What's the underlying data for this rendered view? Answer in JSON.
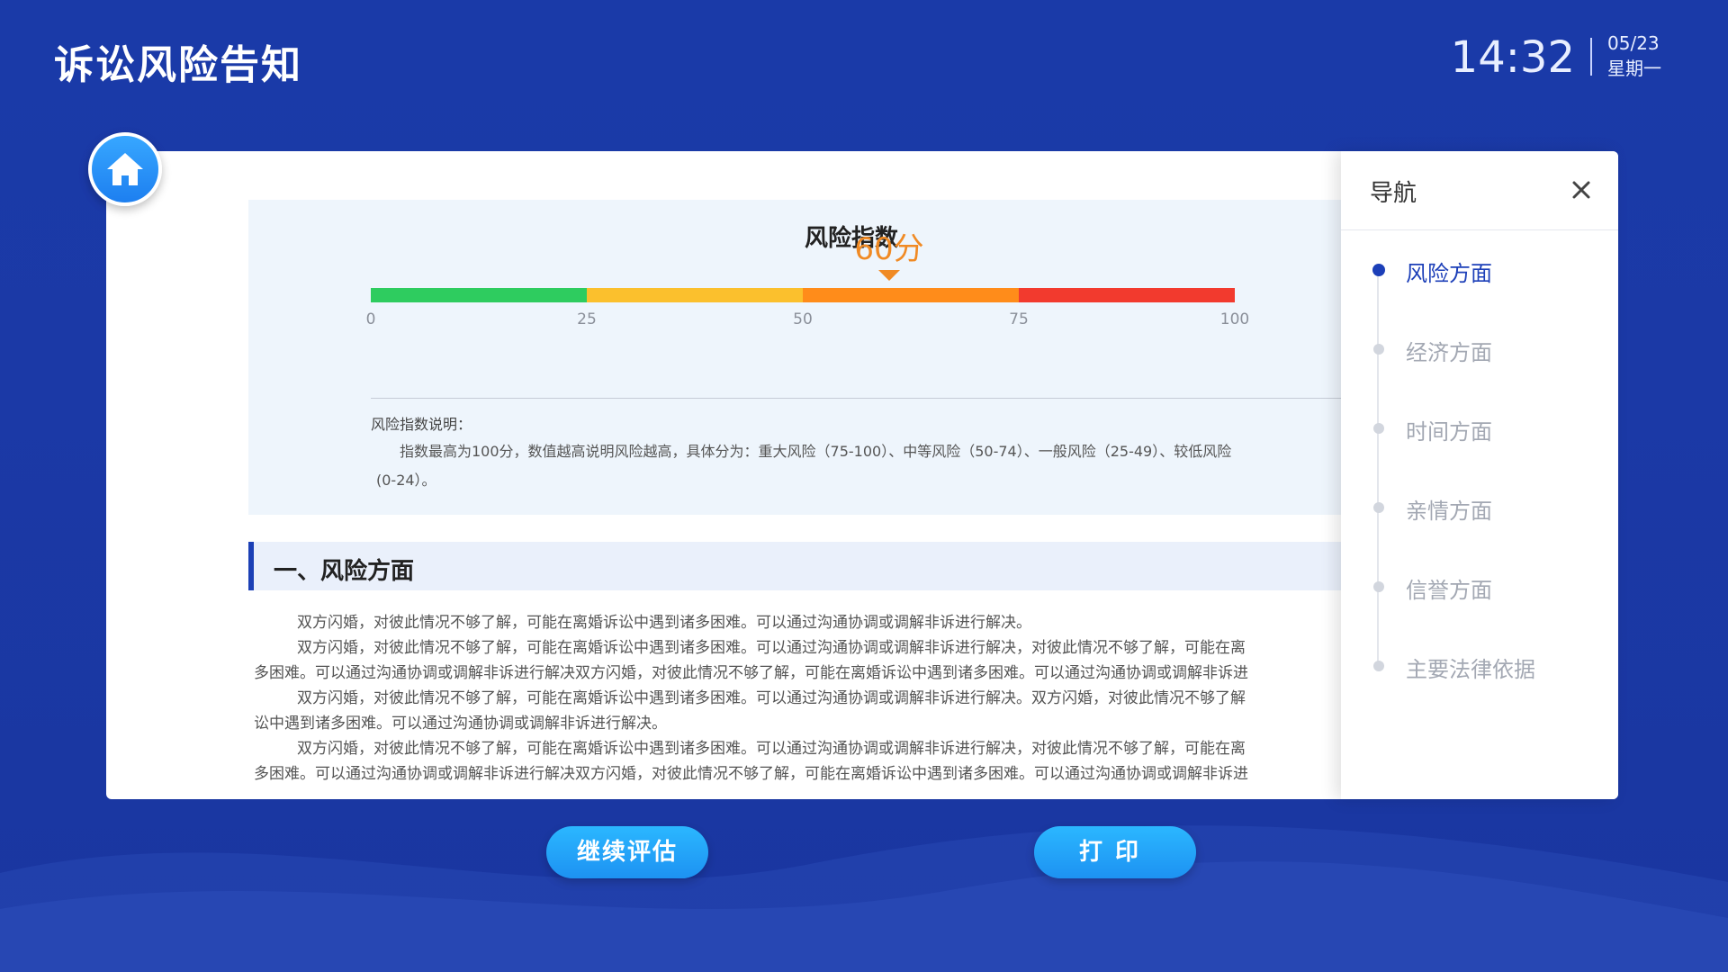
{
  "header": {
    "title": "诉讼风险告知",
    "time": "14:32",
    "date": "05/23",
    "weekday": "星期一"
  },
  "risk_index": {
    "title": "风险指数",
    "score_label": "60分",
    "score": 60,
    "scale": {
      "min": 0,
      "max": 100,
      "ticks": [
        "0",
        "25",
        "50",
        "75",
        "100"
      ]
    },
    "bands": [
      {
        "from": 0,
        "to": 25,
        "color": "#2ecc5f"
      },
      {
        "from": 25,
        "to": 50,
        "color": "#fbc02d"
      },
      {
        "from": 50,
        "to": 75,
        "color": "#ff8c1a"
      },
      {
        "from": 75,
        "to": 100,
        "color": "#f23a2e"
      }
    ],
    "marker_color": "#f08a24",
    "desc_title": "风险指数说明：",
    "desc_line1": "指数最高为100分，数值越高说明风险越高，具体分为：重大风险（75-100）、中等风险（50-74）、一般风险（25-49）、较低风险",
    "desc_line2": "(0-24）。"
  },
  "section": {
    "heading": "一、风险方面",
    "lines": [
      "双方闪婚，对彼此情况不够了解，可能在离婚诉讼中遇到诸多困难。可以通过沟通协调或调解非诉进行解决。",
      "双方闪婚，对彼此情况不够了解，可能在离婚诉讼中遇到诸多困难。可以通过沟通协调或调解非诉进行解决，对彼此情况不够了解，可能在离",
      "多困难。可以通过沟通协调或调解非诉进行解决双方闪婚，对彼此情况不够了解，可能在离婚诉讼中遇到诸多困难。可以通过沟通协调或调解非诉进",
      "双方闪婚，对彼此情况不够了解，可能在离婚诉讼中遇到诸多困难。可以通过沟通协调或调解非诉进行解决。双方闪婚，对彼此情况不够了解",
      "讼中遇到诸多困难。可以通过沟通协调或调解非诉进行解决。",
      "双方闪婚，对彼此情况不够了解，可能在离婚诉讼中遇到诸多困难。可以通过沟通协调或调解非诉进行解决，对彼此情况不够了解，可能在离",
      "多困难。可以通过沟通协调或调解非诉进行解决双方闪婚，对彼此情况不够了解，可能在离婚诉讼中遇到诸多困难。可以通过沟通协调或调解非诉进"
    ]
  },
  "nav": {
    "title": "导航",
    "items": [
      "风险方面",
      "经济方面",
      "时间方面",
      "亲情方面",
      "信誉方面",
      "主要法律依据"
    ],
    "active_index": 0
  },
  "buttons": {
    "continue": "继续评估",
    "print": "打印"
  },
  "colors": {
    "background": "#1b39a6",
    "accent": "#1c3fb8",
    "button": "#1d92f2"
  }
}
